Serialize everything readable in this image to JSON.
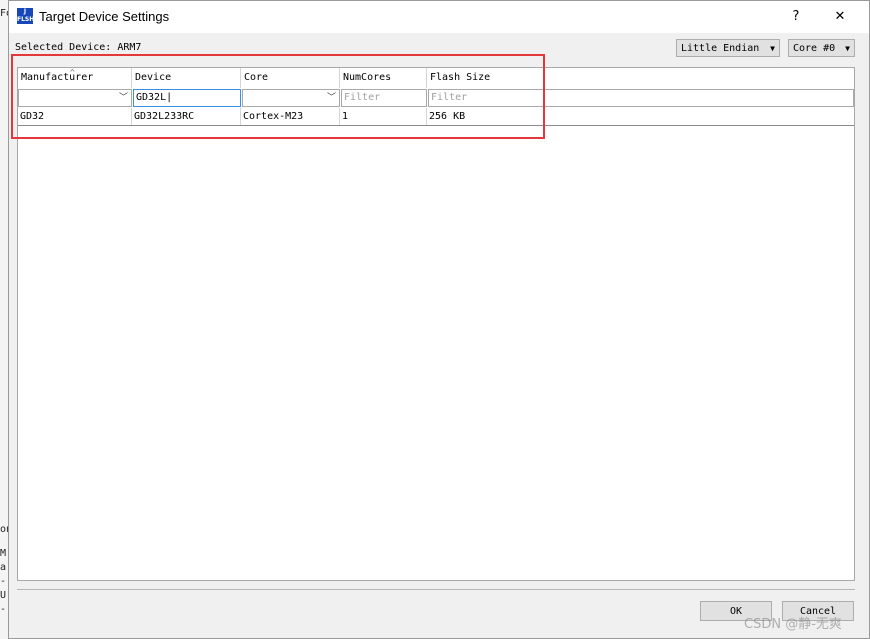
{
  "window": {
    "title": "Target Device Settings",
    "help_label": "?",
    "close_label": "✕"
  },
  "selected_device": {
    "label": "Selected Device: ARM7"
  },
  "endian_select": {
    "value": "Little Endian"
  },
  "core_select": {
    "value": "Core #0"
  },
  "table": {
    "columns": [
      "Manufacturer",
      "Device",
      "Core",
      "NumCores",
      "Flash Size"
    ],
    "filters": {
      "manufacturer": "",
      "device": "GD32L",
      "core": "",
      "numcores_placeholder": "Filter",
      "flash_placeholder": "Filter"
    },
    "rows": [
      {
        "manufacturer": "GD32",
        "device": "GD32L233RC",
        "core": "Cortex-M23",
        "numcores": "1",
        "flash": "256 KB"
      }
    ]
  },
  "buttons": {
    "ok": "OK",
    "cancel": "Cancel"
  },
  "watermark": "CSDN @静-无爽",
  "bg_app": {
    "fragments": [
      "Fo",
      "on",
      "M",
      "a",
      "-",
      "U",
      "-"
    ]
  },
  "colors": {
    "highlight_box": "#e5383b",
    "app_icon": "#1747b8"
  }
}
